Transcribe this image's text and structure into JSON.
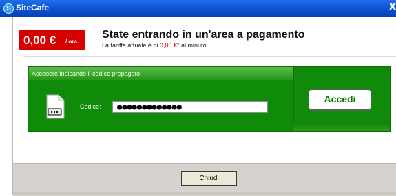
{
  "window": {
    "title": "SiteCafe",
    "close_glyph": "X"
  },
  "rate": {
    "value": "0,00 €",
    "unit": "/ ora."
  },
  "heading": "State entrando in un'area a pagamento",
  "subline": {
    "prefix": "La tariffa attuale è di ",
    "price": "0,00 €",
    "suffix": "* al minuto."
  },
  "login": {
    "panel_title": "Accedere indicando il codice prepagato",
    "code_label": "Codice:",
    "code_value": "●●●●●●●●●●●●●",
    "submit_label": "Accedi"
  },
  "footer": {
    "close_label": "Chiudi"
  },
  "colors": {
    "titlebar": "#0a4fd0",
    "rate_badge": "#d70000",
    "panel": "#108a09",
    "button_text": "#0c7a06"
  },
  "icons": [
    "sitecafe-logo-icon",
    "card-reader-icon"
  ]
}
